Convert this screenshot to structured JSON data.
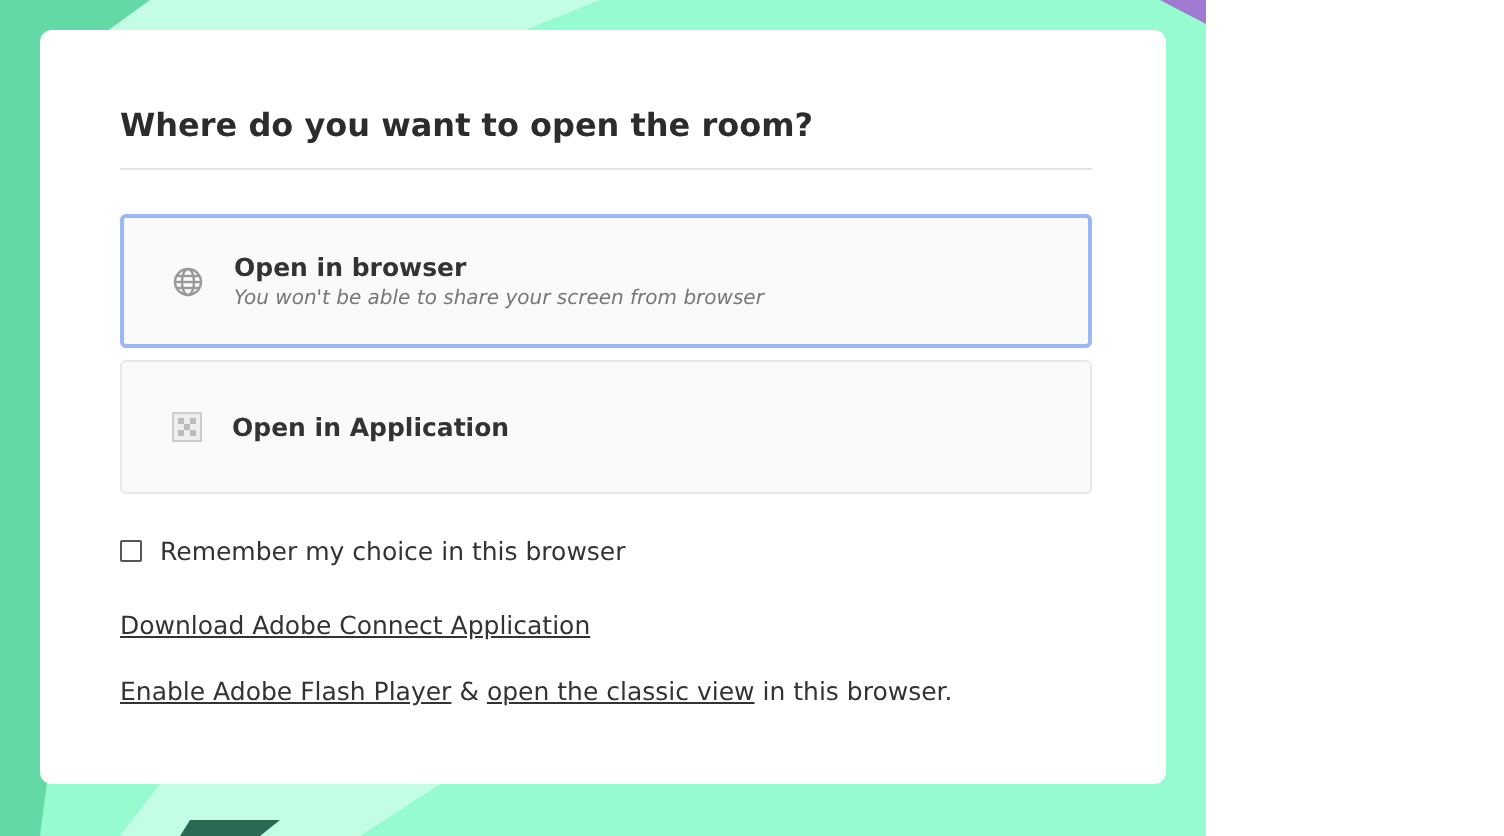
{
  "dialog": {
    "title": "Where do you want to open the room?",
    "options": [
      {
        "kind": "browser",
        "label": "Open in browser",
        "note": "You won't be able to share your screen from browser",
        "selected": true
      },
      {
        "kind": "application",
        "label": "Open in Application",
        "selected": false
      }
    ],
    "remember": {
      "label": "Remember my choice in this browser",
      "checked": false
    },
    "download_link": "Download Adobe Connect Application",
    "footer": {
      "link_1": "Enable Adobe Flash Player",
      "joiner": "&",
      "link_2": "open the classic view",
      "tail": "in this browser."
    }
  }
}
